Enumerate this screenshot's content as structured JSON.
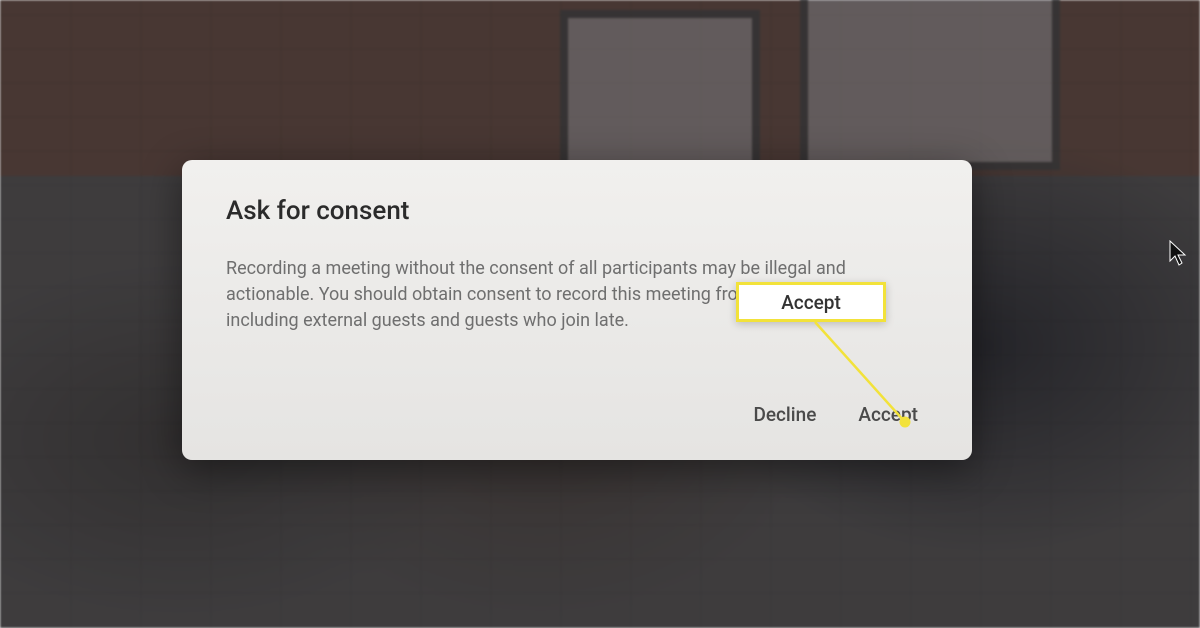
{
  "dialog": {
    "title": "Ask for consent",
    "body": "Recording a meeting without the consent of all participants may be illegal and actionable. You should obtain consent to record this meeting from all participants, including external guests and guests who join late.",
    "decline_label": "Decline",
    "accept_label": "Accept"
  },
  "callout": {
    "label": "Accept"
  }
}
